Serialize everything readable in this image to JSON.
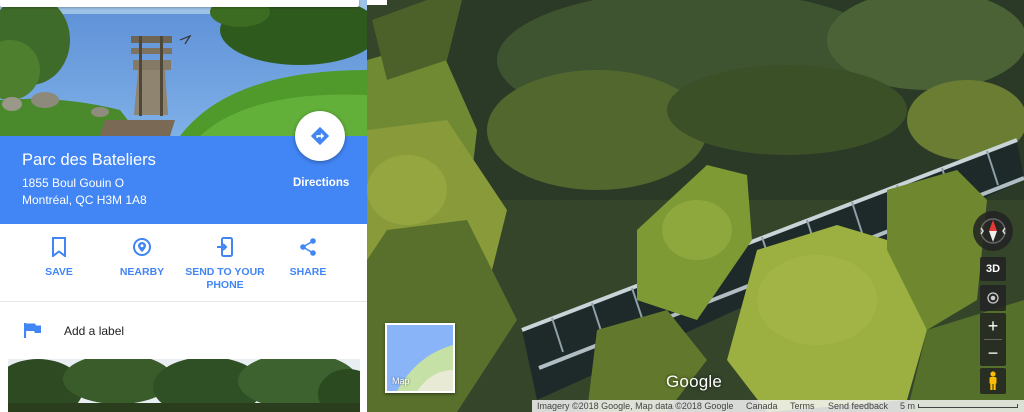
{
  "place": {
    "name": "Parc des Bateliers",
    "address_line1": "1855 Boul Gouin O",
    "address_line2": "Montréal, QC H3M 1A8",
    "directions_label": "Directions"
  },
  "actions": [
    {
      "label": "SAVE",
      "icon": "bookmark-icon"
    },
    {
      "label": "NEARBY",
      "icon": "nearby-pin-icon"
    },
    {
      "label_line1": "SEND TO YOUR",
      "label_line2": "PHONE",
      "icon": "send-to-phone-icon"
    },
    {
      "label": "SHARE",
      "icon": "share-icon"
    }
  ],
  "label_row": {
    "text": "Add a label",
    "icon": "flag-icon"
  },
  "street_view": {
    "map_thumb_label": "Map",
    "logo": "Google",
    "footer": {
      "imagery": "Imagery ©2018 Google, Map data ©2018 Google",
      "country": "Canada",
      "terms": "Terms",
      "feedback": "Send feedback",
      "scale": "5 m"
    },
    "controls": {
      "three_d": "3D",
      "zoom_in": "+",
      "zoom_out": "−"
    }
  },
  "colors": {
    "accent": "#4285f4",
    "compass_red": "#e53935"
  }
}
